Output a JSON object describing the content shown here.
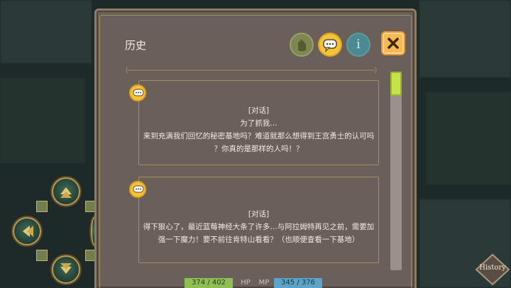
{
  "dialog": {
    "title": "历史",
    "info_symbol": "i"
  },
  "history_entries": [
    {
      "label": "[对话]",
      "lines": [
        "为了抓我…",
        "来到充满我们回忆的秘密基地吗？难道就那么想得到王宫勇士的认可吗",
        "？你真的是那样的人吗！？"
      ]
    },
    {
      "label": "[对话]",
      "lines": [
        "得下狠心了，最近蓝莓神经大条了许多…与阿拉姆特再见之前，需要加",
        "强一下魔力！要不前往肯特山看看？（也顺便查看一下基地）"
      ]
    }
  ],
  "stats": {
    "hp_value": "374 / 402",
    "hp_label": "HP",
    "mp_label": "MP",
    "mp_value": "345 / 376"
  },
  "history_button": {
    "label": "History"
  },
  "colors": {
    "panel": "#6b5f5a",
    "accent_gold": "#f3c33a",
    "close_orange": "#f6b955",
    "scroll_thumb": "#c6e24a",
    "hp_bar": "#8fbf52",
    "mp_bar": "#5ba3c9"
  },
  "icons": [
    "hand-icon",
    "chat-icon",
    "info-icon",
    "close-icon",
    "chat-bubble-icon",
    "history-icon"
  ]
}
